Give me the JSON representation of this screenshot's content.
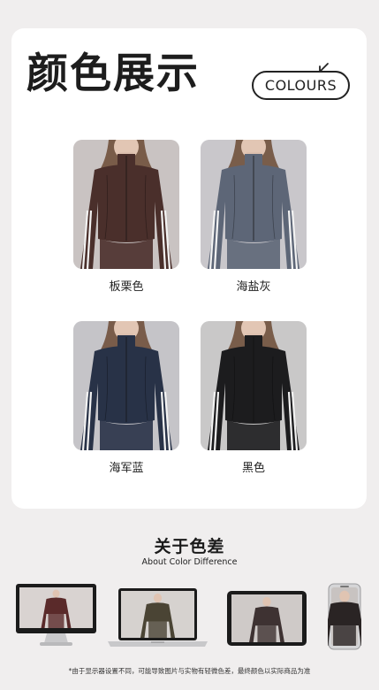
{
  "header": {
    "title": "颜色展示",
    "badge": "COLOURS"
  },
  "colors": [
    {
      "name": "板栗色",
      "jacket": "#4a2f2b",
      "bg": "#c9c3c2"
    },
    {
      "name": "海盐灰",
      "jacket": "#5d6677",
      "bg": "#c9c7cb"
    },
    {
      "name": "海军蓝",
      "jacket": "#283247",
      "bg": "#c5c4c8"
    },
    {
      "name": "黑色",
      "jacket": "#1c1c1e",
      "bg": "#c9c8c8"
    }
  ],
  "section": {
    "title": "关于色差",
    "subtitle": "About Color Difference"
  },
  "devices": [
    {
      "type": "imac",
      "jacket": "#5a2a2a"
    },
    {
      "type": "laptop",
      "jacket": "#4a4434"
    },
    {
      "type": "tablet",
      "jacket": "#3e3232"
    },
    {
      "type": "phone",
      "jacket": "#2a2424"
    }
  ],
  "footnote": "*由于显示器设置不同，可能导致图片与实物有轻微色差，最终颜色以实际商品为准"
}
